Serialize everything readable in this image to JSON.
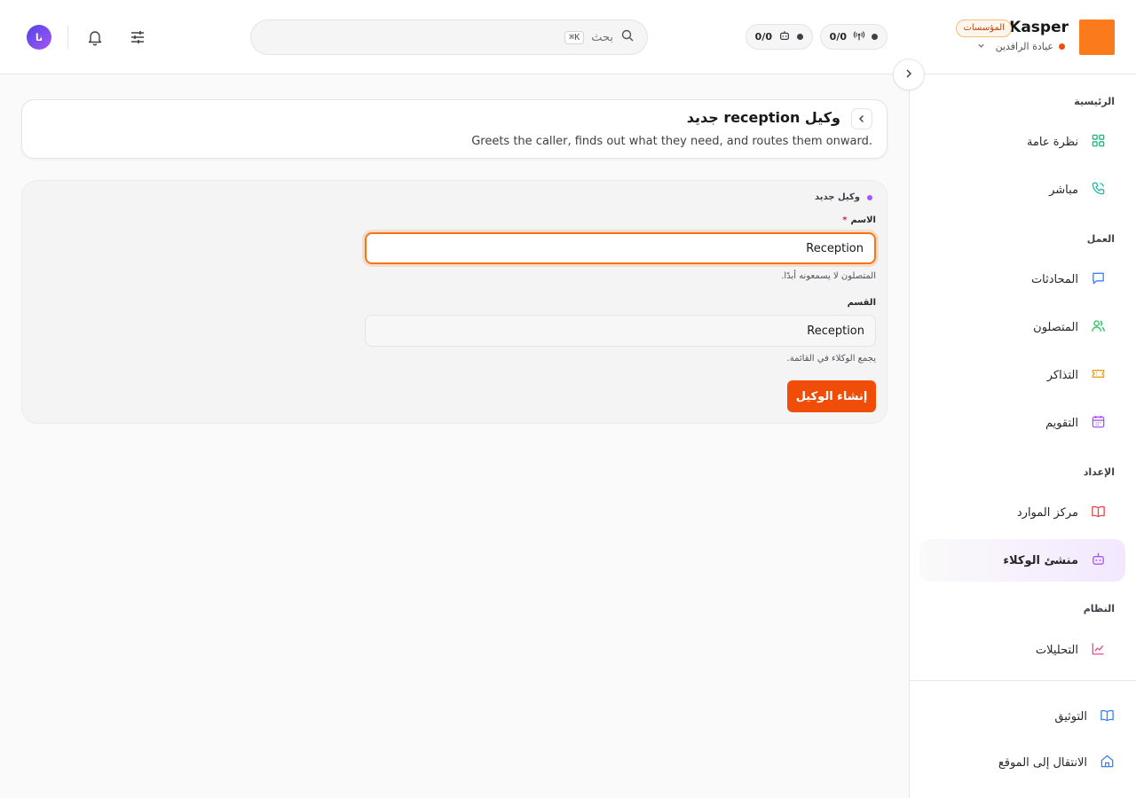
{
  "header": {
    "brand_name": "Kasper",
    "brand_badge": "المؤسسات",
    "org_name": "عيادة الرافدين",
    "stats": [
      {
        "value": "0/0",
        "icon": "antenna-icon"
      },
      {
        "value": "0/0",
        "icon": "bot-icon"
      }
    ],
    "search_placeholder": "بحث",
    "search_shortcut": "⌘K",
    "avatar_initials": "نا"
  },
  "sidebar": {
    "sections": [
      {
        "label": "الرئيسية",
        "items": [
          {
            "label": "نظرة عامة",
            "icon": "grid-icon",
            "color": "#10b981"
          },
          {
            "label": "مباشر",
            "icon": "phone-icon",
            "color": "#14b8a6"
          }
        ]
      },
      {
        "label": "العمل",
        "items": [
          {
            "label": "المحادثات",
            "icon": "chat-icon",
            "color": "#3b82f6"
          },
          {
            "label": "المتصلون",
            "icon": "users-icon",
            "color": "#22c55e"
          },
          {
            "label": "التذاكر",
            "icon": "ticket-icon",
            "color": "#f59e0b"
          },
          {
            "label": "التقويم",
            "icon": "calendar-icon",
            "color": "#a855f7"
          }
        ]
      },
      {
        "label": "الإعداد",
        "items": [
          {
            "label": "مركز الموارد",
            "icon": "book-icon",
            "color": "#ef4444"
          },
          {
            "label": "منشئ الوكلاء",
            "icon": "bot-icon",
            "color": "#a855f7",
            "active": true
          }
        ]
      },
      {
        "label": "النظام",
        "items": [
          {
            "label": "التحليلات",
            "icon": "chart-icon",
            "color": "#ec4899"
          }
        ]
      }
    ],
    "footer": [
      {
        "label": "التوثيق",
        "icon": "book-open-icon",
        "color": "#3b82f6"
      },
      {
        "label": "الانتقال إلى الموقع",
        "icon": "home-icon",
        "color": "#3b82f6"
      }
    ]
  },
  "page": {
    "title": "وكيل reception جديد",
    "subtitle": "Greets the caller, finds out what they need, and routes them onward."
  },
  "form": {
    "tag": "وكيل جديد",
    "name_label": "الاسم",
    "required_mark": "*",
    "name_value": "Reception",
    "name_hint": "المتصلون لا يسمعونه أبدًا.",
    "dept_label": "القسم",
    "dept_value": "Reception",
    "dept_hint": "يجمع الوكلاء في القائمة.",
    "submit_label": "إنشاء الوكيل"
  },
  "colors": {
    "accent": "#f04e08",
    "brand": "#fb7a1c",
    "focus": "#f97316",
    "active_bg": "#f3e8ff"
  }
}
